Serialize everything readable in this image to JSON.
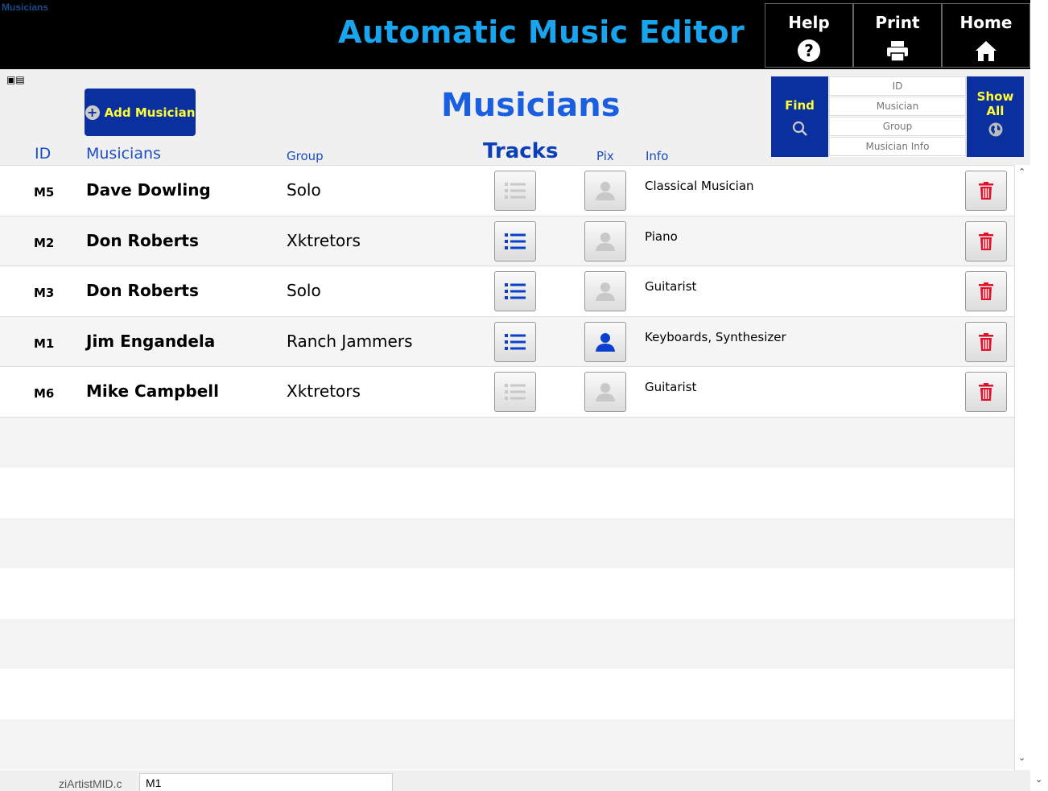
{
  "window": {
    "label": "Musicians"
  },
  "header": {
    "title": "Automatic Music Editor",
    "nav": [
      {
        "label": "Help",
        "icon": "help-circle-icon"
      },
      {
        "label": "Print",
        "icon": "printer-icon"
      },
      {
        "label": "Home",
        "icon": "home-icon"
      }
    ]
  },
  "toolbar": {
    "add_label": "Add Musician",
    "page_title": "Musicians",
    "find_label": "Find",
    "show_all_label": "Show All",
    "find_fields": [
      {
        "placeholder": "ID"
      },
      {
        "placeholder": "Musician"
      },
      {
        "placeholder": "Group"
      },
      {
        "placeholder": "Musician Info"
      }
    ]
  },
  "columns": {
    "id": "ID",
    "musicians": "Musicians",
    "group": "Group",
    "tracks": "Tracks",
    "pix": "Pix",
    "info": "Info"
  },
  "rows": [
    {
      "id": "M5",
      "name": "Dave Dowling",
      "group": "Solo",
      "info": "Classical Musician",
      "has_tracks": false,
      "has_pix": false
    },
    {
      "id": "M2",
      "name": "Don Roberts",
      "group": "Xktretors",
      "info": "Piano",
      "has_tracks": true,
      "has_pix": false
    },
    {
      "id": "M3",
      "name": "Don Roberts",
      "group": "Solo",
      "info": "Guitarist",
      "has_tracks": true,
      "has_pix": false
    },
    {
      "id": "M1",
      "name": "Jim Engandela",
      "group": "Ranch Jammers",
      "info": "Keyboards, Synthesizer",
      "has_tracks": true,
      "has_pix": true
    },
    {
      "id": "M6",
      "name": "Mike Campbell",
      "group": "Xktretors",
      "info": "Guitarist",
      "has_tracks": false,
      "has_pix": false
    }
  ],
  "footer": {
    "field_label": "ziArtistMID.c",
    "field_value": "M1"
  },
  "colors": {
    "navy": "#0a2f9e",
    "yellow": "#ffff33",
    "title_blue": "#19a4ee",
    "active_blue": "#0a3fd0",
    "delete_red": "#e0102a",
    "inactive_gray": "#c8c8c8"
  }
}
